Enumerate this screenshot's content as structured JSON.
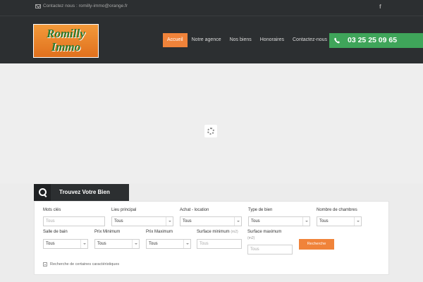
{
  "topbar": {
    "contact_text": "Contactez nous : romilly-immo@orange.fr",
    "social": "f"
  },
  "logo": {
    "line1": "Romilly",
    "line2": "Immo"
  },
  "nav": {
    "items": [
      "Accueil",
      "Notre agence",
      "Nos biens",
      "Honoraires",
      "Contactez-nous"
    ],
    "active": "Accueil"
  },
  "phone": "03 25 25 09 65",
  "colors": {
    "accent": "#f0833a",
    "phone_bg": "#3fa55a",
    "header_bg": "#2c2f31"
  },
  "search": {
    "title": "Trouvez Votre Bien",
    "fields": {
      "mots_cles": {
        "label": "Mots clés",
        "placeholder": "Tous"
      },
      "lieu": {
        "label": "Lieu principal",
        "value": "Tous"
      },
      "achat": {
        "label": "Achat - location",
        "value": "Tous"
      },
      "type": {
        "label": "Type de bien",
        "value": "Tous"
      },
      "chambres": {
        "label": "Nombre de chambres",
        "value": "Tous"
      },
      "salle": {
        "label": "Salle de bain",
        "value": "Tous"
      },
      "prix_min": {
        "label": "Prix Minimum",
        "value": "Tous"
      },
      "prix_max": {
        "label": "Prix Maximum",
        "value": "Tous"
      },
      "surf_min": {
        "label": "Surface minimum",
        "unit": "(m2)",
        "placeholder": "Tous"
      },
      "surf_max": {
        "label": "Surface maximum",
        "unit": "(m2)",
        "placeholder": "Tous"
      }
    },
    "button": "Recherche",
    "advanced": "Recherche de certaines caractéristiques"
  }
}
